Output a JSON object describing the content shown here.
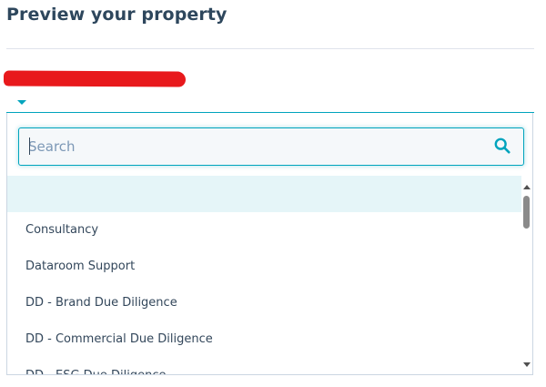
{
  "header": {
    "title": "Preview your property"
  },
  "search": {
    "placeholder": "Search",
    "value": ""
  },
  "options": [
    "",
    "Consultancy",
    "Dataroom Support",
    "DD - Brand Due Diligence",
    "DD - Commercial Due Diligence",
    "DD - ESG Due Diligence"
  ],
  "colors": {
    "accent": "#00a4bd",
    "title_text": "#2e475d",
    "option_text": "#33475b",
    "highlight": "#e5f5f8",
    "redaction": "#e8191c"
  },
  "icons": {
    "search": "search-icon",
    "caret": "caret-down-icon"
  }
}
